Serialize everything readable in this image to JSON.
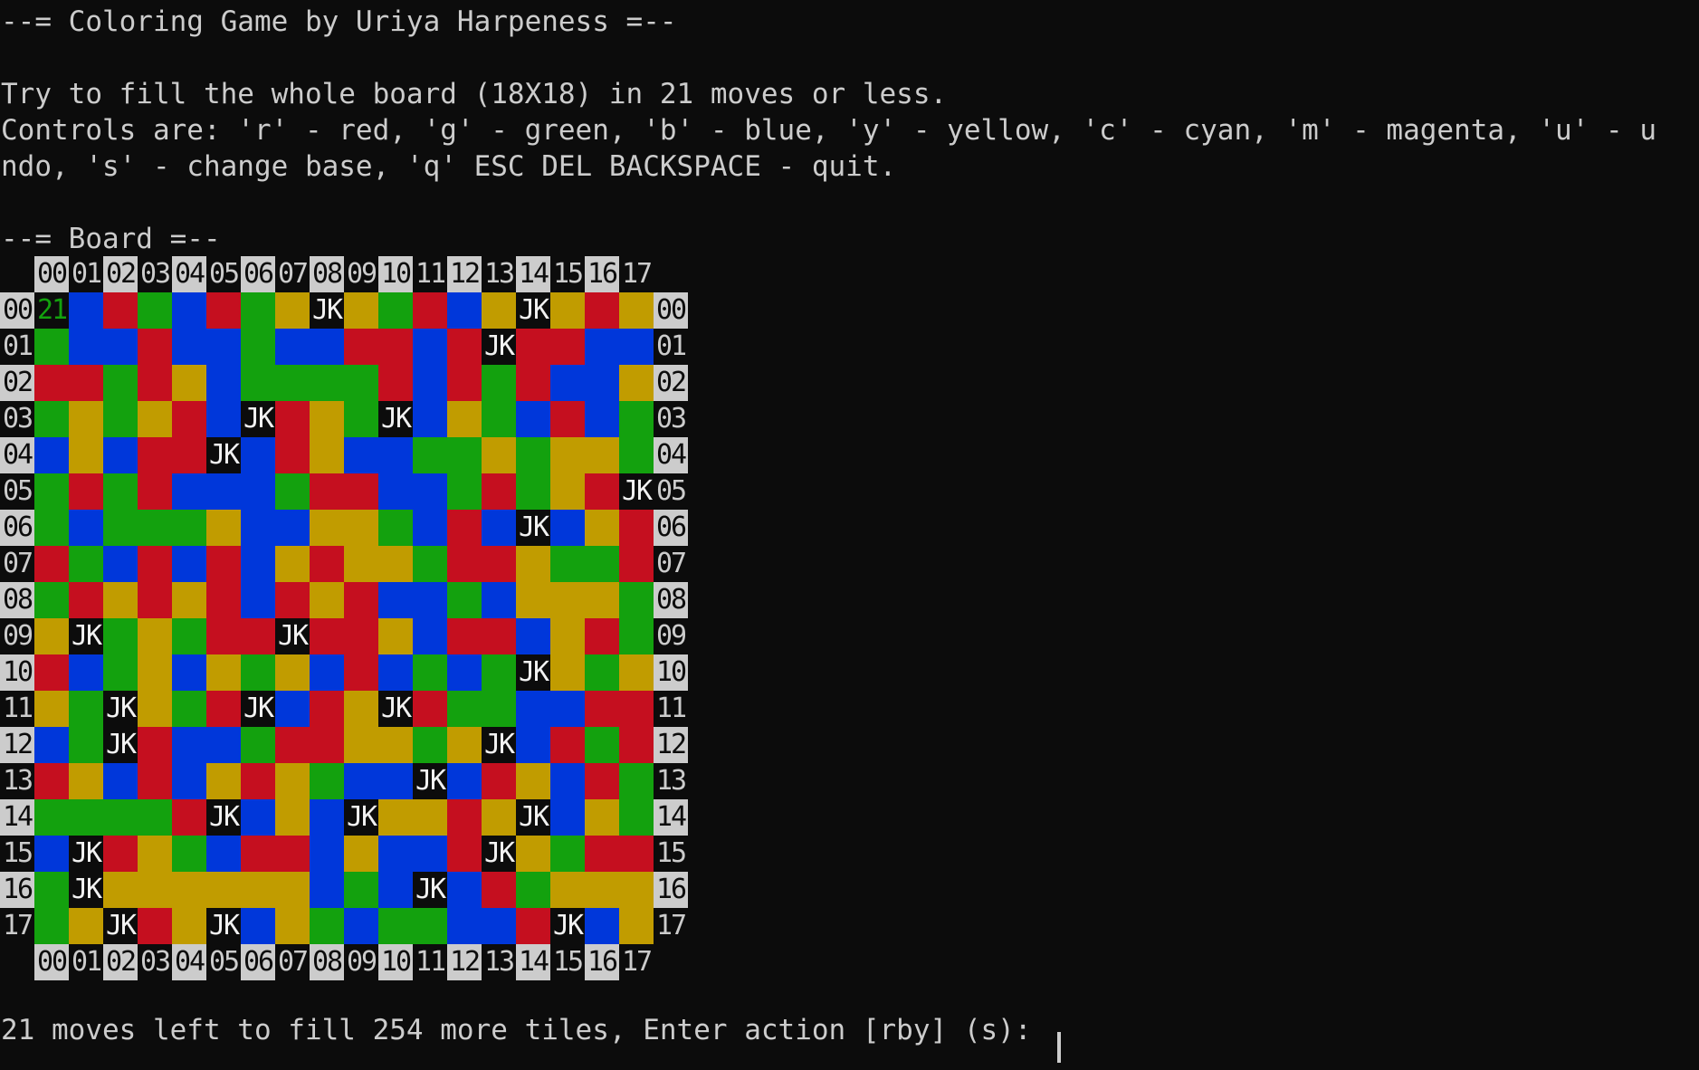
{
  "title_line": "--= Coloring Game by Uriya Harpeness =--",
  "intro_line": "Try to fill the whole board (18X18) in 21 moves or less.",
  "controls_line1": "Controls are: 'r' - red, 'g' - green, 'b' - blue, 'y' - yellow, 'c' - cyan, 'm' - magenta, 'u' - u",
  "controls_line2": "ndo, 's' - change base, 'q' ESC DEL BACKSPACE - quit.",
  "board_heading": "--= Board =--",
  "status_line": "21 moves left to fill 254 more tiles, Enter action [rby] (s):",
  "board": {
    "size": 18,
    "moves_left_marker": "21",
    "joker_label": "JK",
    "col_labels": [
      "00",
      "01",
      "02",
      "03",
      "04",
      "05",
      "06",
      "07",
      "08",
      "09",
      "10",
      "11",
      "12",
      "13",
      "14",
      "15",
      "16",
      "17"
    ],
    "row_labels": [
      "00",
      "01",
      "02",
      "03",
      "04",
      "05",
      "06",
      "07",
      "08",
      "09",
      "10",
      "11",
      "12",
      "13",
      "14",
      "15",
      "16",
      "17"
    ],
    "palette": {
      "R": "#c50f1f",
      "G": "#13a10e",
      "B": "#0037da",
      "Y": "#c19c00",
      "K": "#0c0c0c",
      "W": "#cccccc",
      "S": "#13a10e"
    },
    "rows": [
      [
        "S",
        "B",
        "R",
        "G",
        "B",
        "R",
        "G",
        "Y",
        "J",
        "Y",
        "G",
        "R",
        "B",
        "Y",
        "J",
        "Y",
        "R",
        "Y"
      ],
      [
        "G",
        "B",
        "B",
        "R",
        "B",
        "B",
        "G",
        "B",
        "B",
        "R",
        "R",
        "B",
        "R",
        "J",
        "R",
        "R",
        "B",
        "B"
      ],
      [
        "R",
        "R",
        "G",
        "R",
        "Y",
        "B",
        "G",
        "G",
        "G",
        "G",
        "R",
        "B",
        "R",
        "G",
        "R",
        "B",
        "B",
        "Y"
      ],
      [
        "G",
        "Y",
        "G",
        "Y",
        "R",
        "B",
        "J",
        "R",
        "Y",
        "G",
        "J",
        "B",
        "Y",
        "G",
        "B",
        "R",
        "B",
        "G"
      ],
      [
        "B",
        "Y",
        "B",
        "R",
        "R",
        "J",
        "B",
        "R",
        "Y",
        "B",
        "B",
        "G",
        "G",
        "Y",
        "G",
        "Y",
        "Y",
        "G"
      ],
      [
        "G",
        "R",
        "G",
        "R",
        "B",
        "B",
        "B",
        "G",
        "R",
        "R",
        "B",
        "B",
        "G",
        "R",
        "G",
        "Y",
        "R",
        "J"
      ],
      [
        "G",
        "B",
        "G",
        "G",
        "G",
        "Y",
        "B",
        "B",
        "Y",
        "Y",
        "G",
        "B",
        "R",
        "B",
        "J",
        "B",
        "Y",
        "R"
      ],
      [
        "R",
        "G",
        "B",
        "R",
        "B",
        "R",
        "B",
        "Y",
        "R",
        "Y",
        "Y",
        "G",
        "R",
        "R",
        "Y",
        "G",
        "G",
        "R"
      ],
      [
        "G",
        "R",
        "Y",
        "R",
        "Y",
        "R",
        "B",
        "R",
        "Y",
        "R",
        "B",
        "B",
        "G",
        "B",
        "Y",
        "Y",
        "Y",
        "G"
      ],
      [
        "Y",
        "J",
        "G",
        "Y",
        "G",
        "R",
        "R",
        "J",
        "R",
        "R",
        "Y",
        "B",
        "R",
        "R",
        "B",
        "Y",
        "R",
        "G"
      ],
      [
        "R",
        "B",
        "G",
        "Y",
        "B",
        "Y",
        "G",
        "Y",
        "B",
        "R",
        "B",
        "G",
        "B",
        "G",
        "J",
        "Y",
        "G",
        "Y"
      ],
      [
        "Y",
        "G",
        "J",
        "Y",
        "G",
        "R",
        "J",
        "B",
        "R",
        "Y",
        "J",
        "R",
        "G",
        "G",
        "B",
        "B",
        "R",
        "R"
      ],
      [
        "B",
        "G",
        "J",
        "R",
        "B",
        "B",
        "G",
        "R",
        "R",
        "Y",
        "Y",
        "G",
        "Y",
        "J",
        "B",
        "R",
        "G",
        "R"
      ],
      [
        "R",
        "Y",
        "B",
        "R",
        "B",
        "Y",
        "R",
        "Y",
        "G",
        "B",
        "B",
        "J",
        "B",
        "R",
        "Y",
        "B",
        "R",
        "G"
      ],
      [
        "G",
        "G",
        "G",
        "G",
        "R",
        "J",
        "B",
        "Y",
        "B",
        "J",
        "Y",
        "Y",
        "R",
        "Y",
        "J",
        "B",
        "Y",
        "G"
      ],
      [
        "B",
        "J",
        "R",
        "Y",
        "G",
        "B",
        "R",
        "R",
        "B",
        "Y",
        "B",
        "B",
        "R",
        "J",
        "Y",
        "G",
        "R",
        "R"
      ],
      [
        "G",
        "J",
        "Y",
        "Y",
        "Y",
        "Y",
        "Y",
        "Y",
        "B",
        "G",
        "B",
        "J",
        "B",
        "R",
        "G",
        "Y",
        "Y",
        "Y"
      ],
      [
        "G",
        "Y",
        "J",
        "R",
        "Y",
        "J",
        "B",
        "Y",
        "G",
        "B",
        "G",
        "G",
        "B",
        "B",
        "R",
        "J",
        "B",
        "Y"
      ]
    ]
  }
}
